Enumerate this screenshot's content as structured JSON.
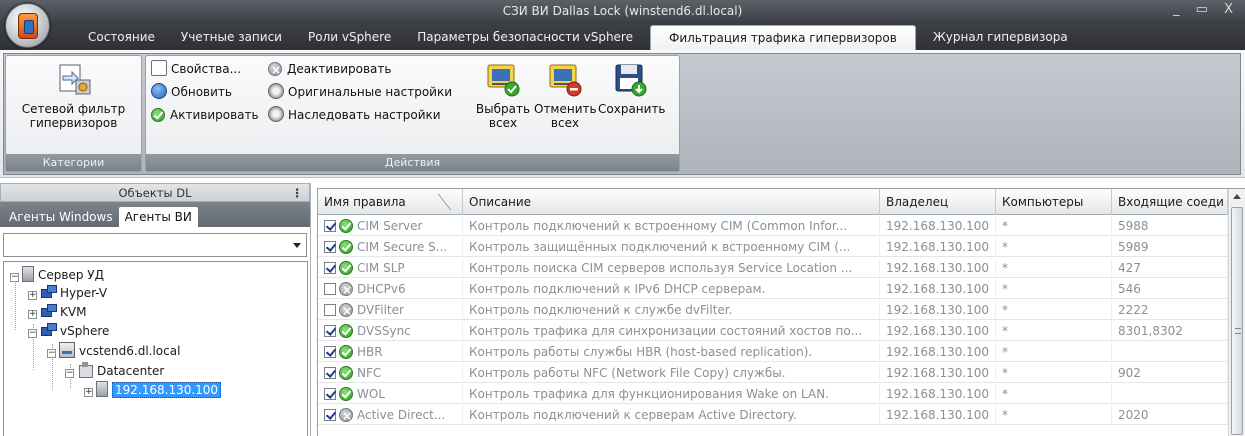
{
  "window": {
    "title": "СЗИ ВИ Dallas Lock (winstend6.dl.local)",
    "controls": [
      "_",
      "▭",
      "X"
    ]
  },
  "tabs": [
    {
      "label": "Состояние"
    },
    {
      "label": "Учетные записи"
    },
    {
      "label": "Роли vSphere"
    },
    {
      "label": "Параметры безопасности vSphere"
    },
    {
      "label": "Фильтрация трафика гипервизоров",
      "active": true
    },
    {
      "label": "Журнал гипервизора"
    }
  ],
  "ribbon": {
    "categories": {
      "label": "Категории",
      "button_line1": "Сетевой фильтр",
      "button_line2": "гипервизоров"
    },
    "actions": {
      "label": "Действия",
      "properties": "Свойства...",
      "refresh": "Обновить",
      "activate": "Активировать",
      "deactivate": "Деактивировать",
      "original_settings": "Оригинальные настройки",
      "inherit_settings": "Наследовать настройки",
      "select_all_1": "Выбрать",
      "select_all_2": "всех",
      "cancel_all_1": "Отменить",
      "cancel_all_2": "всех",
      "save": "Сохранить"
    }
  },
  "left_panel": {
    "title": "Объекты DL",
    "tabs": [
      "Агенты Windows",
      "Агенты ВИ"
    ],
    "active_tab": "Агенты ВИ",
    "combo_value": "",
    "tree": {
      "root": "Сервер УД",
      "hyperv": "Hyper-V",
      "kvm": "KVM",
      "vsphere": "vSphere",
      "vcenter": "vcstend6.dl.local",
      "datacenter": "Datacenter",
      "host": "192.168.130.100"
    }
  },
  "grid": {
    "columns": [
      "Имя правила",
      "Описание",
      "Владелец",
      "Компьютеры",
      "Входящие соеди"
    ],
    "rows": [
      {
        "checked": true,
        "active": true,
        "name": "CIM Server",
        "desc": "Контроль подключений к встроенному CIM (Common Infor...",
        "owner": "192.168.130.100",
        "computers": "*",
        "incoming": "5988"
      },
      {
        "checked": true,
        "active": true,
        "name": "CIM Secure S...",
        "desc": "Контроль защищённых подключений к встроенному CIM (...",
        "owner": "192.168.130.100",
        "computers": "*",
        "incoming": "5989"
      },
      {
        "checked": true,
        "active": true,
        "name": "CIM SLP",
        "desc": "Контроль поиска CIM серверов используя Service Location ...",
        "owner": "192.168.130.100",
        "computers": "*",
        "incoming": "427"
      },
      {
        "checked": false,
        "active": false,
        "name": "DHCPv6",
        "desc": "Контроль подключений к IPv6 DHCP серверам.",
        "owner": "192.168.130.100",
        "computers": "*",
        "incoming": "546"
      },
      {
        "checked": false,
        "active": false,
        "name": "DVFilter",
        "desc": "Контроль подключений к службе dvFilter.",
        "owner": "192.168.130.100",
        "computers": "*",
        "incoming": "2222"
      },
      {
        "checked": true,
        "active": true,
        "name": "DVSSync",
        "desc": "Контроль трафика для синхронизации состояний хостов по...",
        "owner": "192.168.130.100",
        "computers": "*",
        "incoming": "8301,8302"
      },
      {
        "checked": true,
        "active": true,
        "name": "HBR",
        "desc": "Контроль работы службы HBR (host-based replication).",
        "owner": "192.168.130.100",
        "computers": "*",
        "incoming": ""
      },
      {
        "checked": true,
        "active": true,
        "name": "NFC",
        "desc": "Контроль работы NFC (Network File Copy) службы.",
        "owner": "192.168.130.100",
        "computers": "*",
        "incoming": "902"
      },
      {
        "checked": true,
        "active": true,
        "name": "WOL",
        "desc": "Контроль трафика для функционирования Wake on LAN.",
        "owner": "192.168.130.100",
        "computers": "*",
        "incoming": ""
      },
      {
        "checked": true,
        "active": false,
        "name": "Active Direct...",
        "desc": "Контроль подключений к серверам Active Directory.",
        "owner": "192.168.130.100",
        "computers": "*",
        "incoming": "2020"
      }
    ]
  }
}
